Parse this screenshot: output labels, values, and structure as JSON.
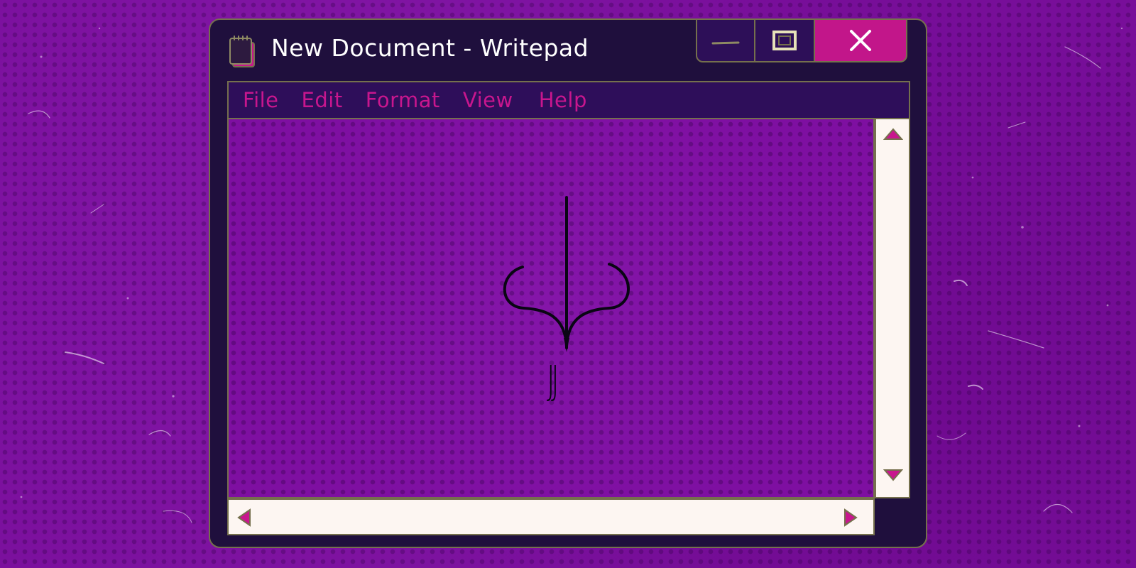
{
  "window": {
    "title": "New Document - Writepad",
    "controls": {
      "minimize": "minimize",
      "maximize": "maximize",
      "close": "close"
    }
  },
  "menu": {
    "items": [
      "File",
      "Edit",
      "Format",
      "View",
      "Help"
    ]
  },
  "document": {
    "initials": "JJ"
  },
  "colors": {
    "background": "#7a0f9c",
    "window_frame": "#1f0f3d",
    "frame_border": "#75704d",
    "menu_text": "#c8168e",
    "close_button": "#c2168a",
    "scrollbar_track": "#fdf6f2"
  },
  "icons": {
    "document": "notepad-icon",
    "minimize": "minimize-icon",
    "maximize": "maximize-icon",
    "close": "close-icon",
    "scroll_up": "triangle-up-icon",
    "scroll_down": "triangle-down-icon",
    "scroll_left": "triangle-left-icon",
    "scroll_right": "triangle-right-icon"
  }
}
